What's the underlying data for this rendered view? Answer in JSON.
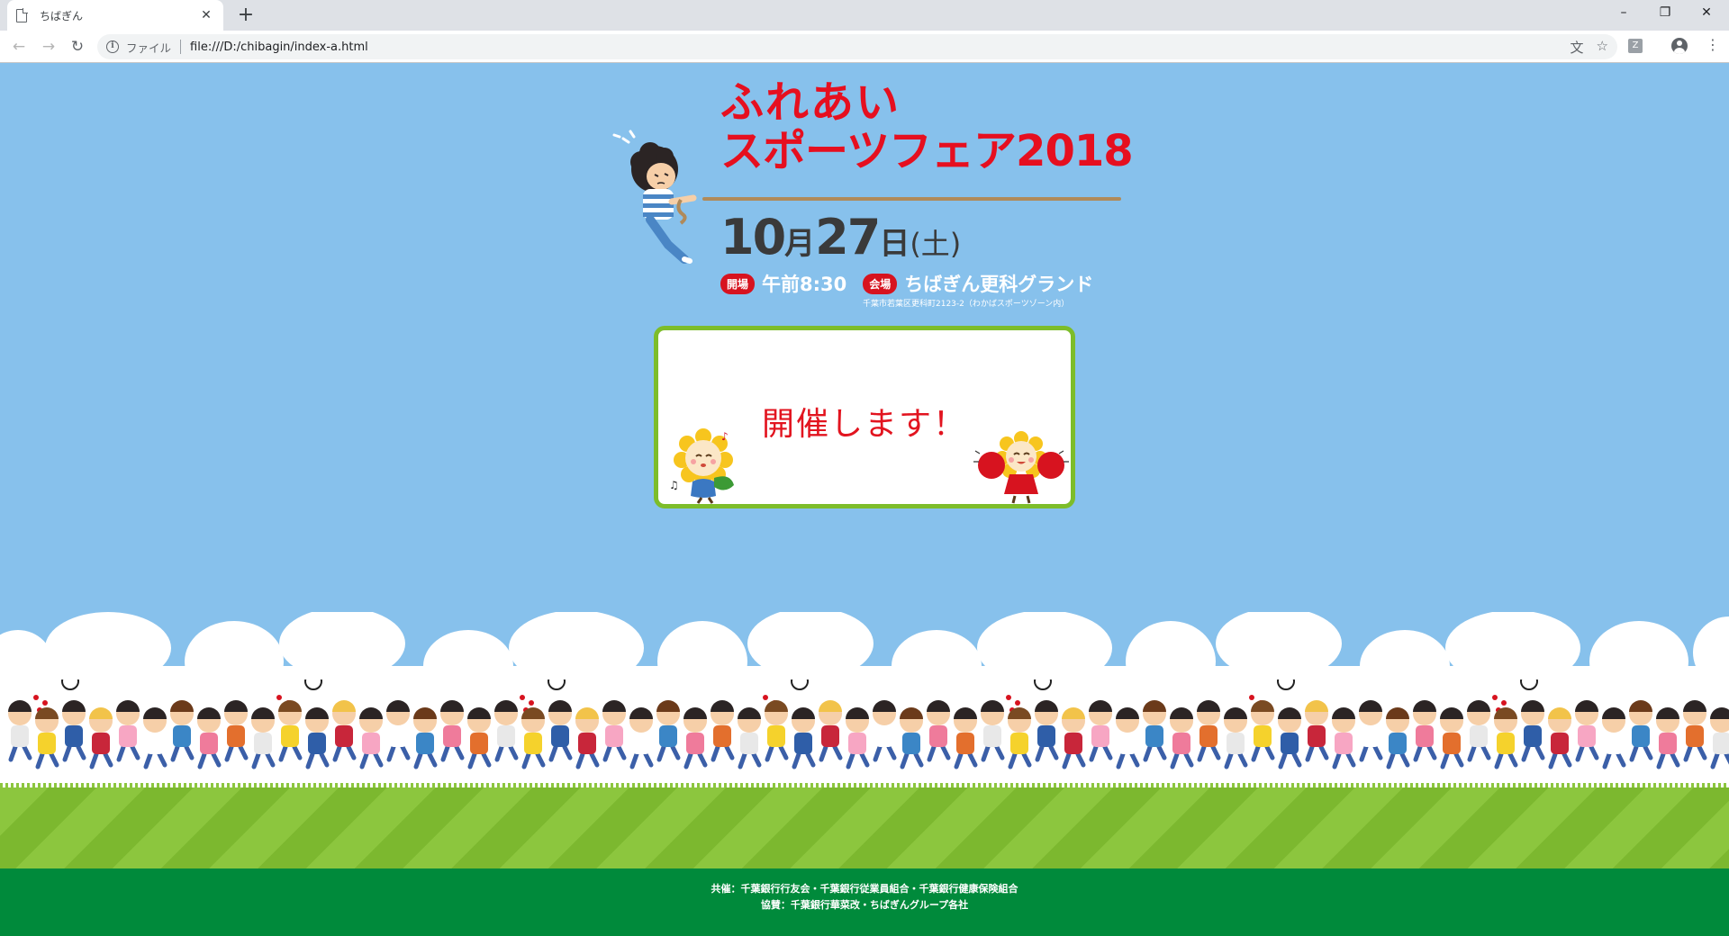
{
  "browser": {
    "tab_title": "ちばぎん",
    "tab_close": "✕",
    "new_tab": "+",
    "window_controls": {
      "minimize": "–",
      "maximize": "❐",
      "close": "✕"
    },
    "nav": {
      "back": "←",
      "forward": "→",
      "reload": "↻"
    },
    "omnibox": {
      "info_icon": "i",
      "origin_label": "ファイル",
      "url": "file:///D:/chibagin/index-a.html"
    },
    "icons": {
      "translate": "translate-icon",
      "bookmark": "star-icon",
      "extension": "extension-icon",
      "profile": "account-icon",
      "menu": "kebab-menu-icon"
    },
    "extension_label": "Z",
    "menu_glyph": "⋮",
    "translate_glyph": "文",
    "star_glyph": "☆"
  },
  "event": {
    "title_line1": "ふれあい",
    "title_line2": "スポーツフェア2018",
    "date": {
      "month": "10",
      "month_unit": "月",
      "day": "27",
      "day_unit": "日",
      "weekday": "(土)"
    },
    "open_badge": "開場",
    "open_time": "午前8:30",
    "venue_badge": "会場",
    "venue": "ちばぎん更科グランド",
    "address": "千葉市若葉区更科町2123-2（わかばスポーツゾーン内）"
  },
  "notice": {
    "message": "開催します！"
  },
  "footer": {
    "line1": "共催：千葉銀行行友会・千葉銀行従業員組合・千葉銀行健康保険組合",
    "line2": "協賛：千葉銀行華菜改・ちばぎんグループ各社"
  },
  "colors": {
    "sky": "#87c1ec",
    "title_red": "#e60f1f",
    "badge_red": "#d7131f",
    "card_border": "#7dbd2a",
    "grass": "#8cc63e",
    "footer_green": "#008a3b"
  }
}
